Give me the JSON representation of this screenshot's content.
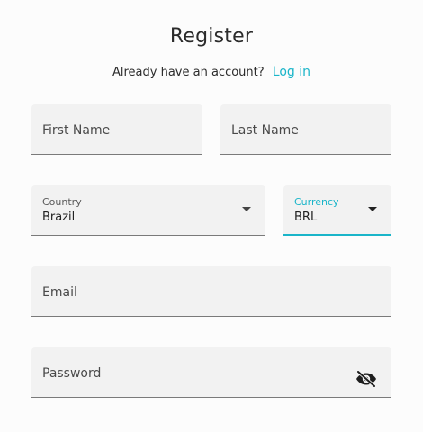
{
  "header": {
    "title": "Register",
    "login_prompt": "Already have an account?",
    "login_link": "Log in"
  },
  "form": {
    "first_name": {
      "placeholder": "First Name",
      "value": ""
    },
    "last_name": {
      "placeholder": "Last Name",
      "value": ""
    },
    "country": {
      "label": "Country",
      "value": "Brazil"
    },
    "currency": {
      "label": "Currency",
      "value": "BRL",
      "focused": true
    },
    "email": {
      "placeholder": "Email",
      "value": ""
    },
    "password": {
      "placeholder": "Password",
      "value": "",
      "toggle_icon": "eye-off-icon"
    }
  },
  "colors": {
    "accent": "#1ab5c9",
    "field_bg": "#f2f2f2",
    "underline": "#7a7a7a"
  }
}
